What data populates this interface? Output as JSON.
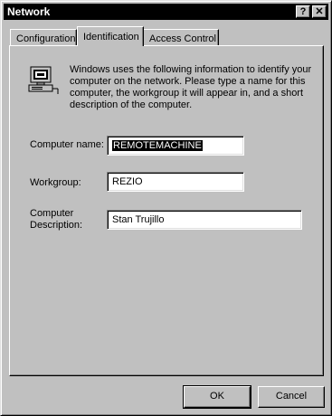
{
  "window": {
    "title": "Network",
    "help_button": "?",
    "close_button": "✕"
  },
  "tabs": [
    {
      "label": "Configuration",
      "active": false
    },
    {
      "label": "Identification",
      "active": true
    },
    {
      "label": "Access Control",
      "active": false
    }
  ],
  "identification": {
    "icon": "network-computer-icon",
    "info_text": "Windows uses the following information to identify your computer on the network.  Please type a name for this computer, the workgroup it will appear in, and a short description of the computer.",
    "computer_name_label": "Computer name:",
    "computer_name_value": "REMOTEMACHINE",
    "workgroup_label": "Workgroup:",
    "workgroup_value": "REZIO",
    "description_label": "Computer Description:",
    "description_value": "Stan Trujillo"
  },
  "buttons": {
    "ok": "OK",
    "cancel": "Cancel"
  }
}
